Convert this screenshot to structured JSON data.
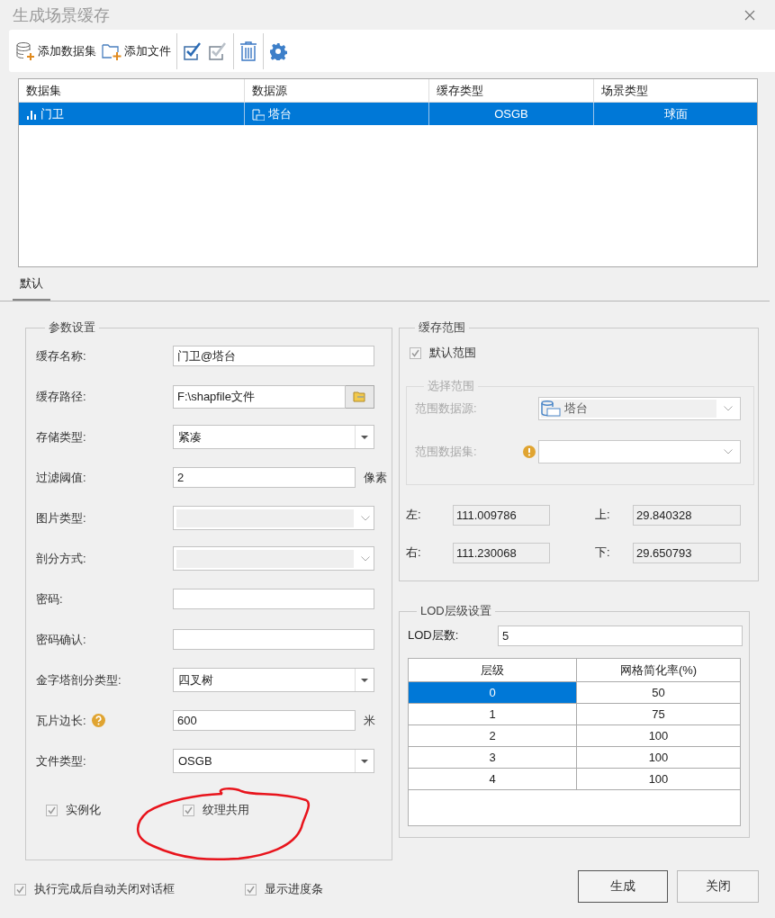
{
  "window": {
    "title": "生成场景缓存"
  },
  "toolbar": {
    "groups": [
      {
        "items": [
          {
            "kind": "add-dataset",
            "label": "添加数据集"
          },
          {
            "kind": "add-file",
            "label": "添加文件"
          }
        ]
      },
      {
        "items": [
          {
            "kind": "select-all"
          },
          {
            "kind": "invert-select"
          }
        ]
      },
      {
        "items": [
          {
            "kind": "delete"
          }
        ]
      },
      {
        "items": [
          {
            "kind": "settings"
          }
        ]
      }
    ]
  },
  "dataset_table": {
    "columns": [
      "数据集",
      "数据源",
      "缓存类型",
      "场景类型"
    ],
    "rows": [
      {
        "selected": true,
        "dataset": "门卫",
        "datasource": "塔台",
        "cache_type": "OSGB",
        "scene_type": "球面"
      }
    ]
  },
  "tabs": [
    {
      "label": "默认",
      "selected": true
    }
  ],
  "params": {
    "title": "参数设置",
    "fields": [
      {
        "kind": "text",
        "label": "缓存名称:",
        "value": "门卫@塔台"
      },
      {
        "kind": "browse",
        "label": "缓存路径:",
        "value": "F:\\shapfile文件"
      },
      {
        "kind": "select",
        "label": "存储类型:",
        "value": "紧凑"
      },
      {
        "kind": "unit",
        "label": "过滤阈值:",
        "value": "2",
        "unit": "像素"
      },
      {
        "kind": "disabled-select",
        "label": "图片类型:"
      },
      {
        "kind": "disabled-select",
        "label": "剖分方式:"
      },
      {
        "kind": "text",
        "label": "密码:"
      },
      {
        "kind": "text",
        "label": "密码确认:"
      },
      {
        "kind": "select",
        "label": "金字塔剖分类型:",
        "value": "四叉树"
      },
      {
        "kind": "unit",
        "label": "瓦片边长:",
        "help": true,
        "value": "600",
        "unit": "米"
      },
      {
        "kind": "select",
        "label": "文件类型:",
        "value": "OSGB"
      }
    ],
    "options": [
      {
        "label": "实例化",
        "checked": true,
        "disabled": true
      },
      {
        "label": "纹理共用",
        "checked": true,
        "disabled": true
      }
    ]
  },
  "cache_range": {
    "title": "缓存范围",
    "default_range": {
      "label": "默认范围",
      "checked": true,
      "disabled": true
    },
    "select_range": {
      "title": "选择范围",
      "disabled": true,
      "datasource": {
        "label": "范围数据源:",
        "value": "塔台"
      },
      "dataset": {
        "label": "范围数据集:",
        "warning": true
      }
    },
    "bounds": [
      {
        "label": "左:",
        "value": "111.009786"
      },
      {
        "label": "上:",
        "value": "29.840328"
      },
      {
        "label": "右:",
        "value": "111.230068"
      },
      {
        "label": "下:",
        "value": "29.650793"
      }
    ]
  },
  "lod": {
    "title": "LOD层级设置",
    "count_label": "LOD层数:",
    "count": "5",
    "columns": [
      "层级",
      "网格简化率(%)"
    ],
    "rows": [
      {
        "level": "0",
        "rate": "50",
        "selected": true
      },
      {
        "level": "1",
        "rate": "75",
        "selected": false
      },
      {
        "level": "2",
        "rate": "100",
        "selected": false
      },
      {
        "level": "3",
        "rate": "100",
        "selected": false
      },
      {
        "level": "4",
        "rate": "100",
        "selected": false
      }
    ]
  },
  "footer": {
    "options": [
      {
        "label": "执行完成后自动关闭对话框",
        "checked": true,
        "disabled": true
      },
      {
        "label": "显示进度条",
        "checked": true,
        "disabled": true
      }
    ],
    "buttons": [
      {
        "label": "生成",
        "default": true
      },
      {
        "label": "关闭",
        "default": false
      }
    ]
  }
}
